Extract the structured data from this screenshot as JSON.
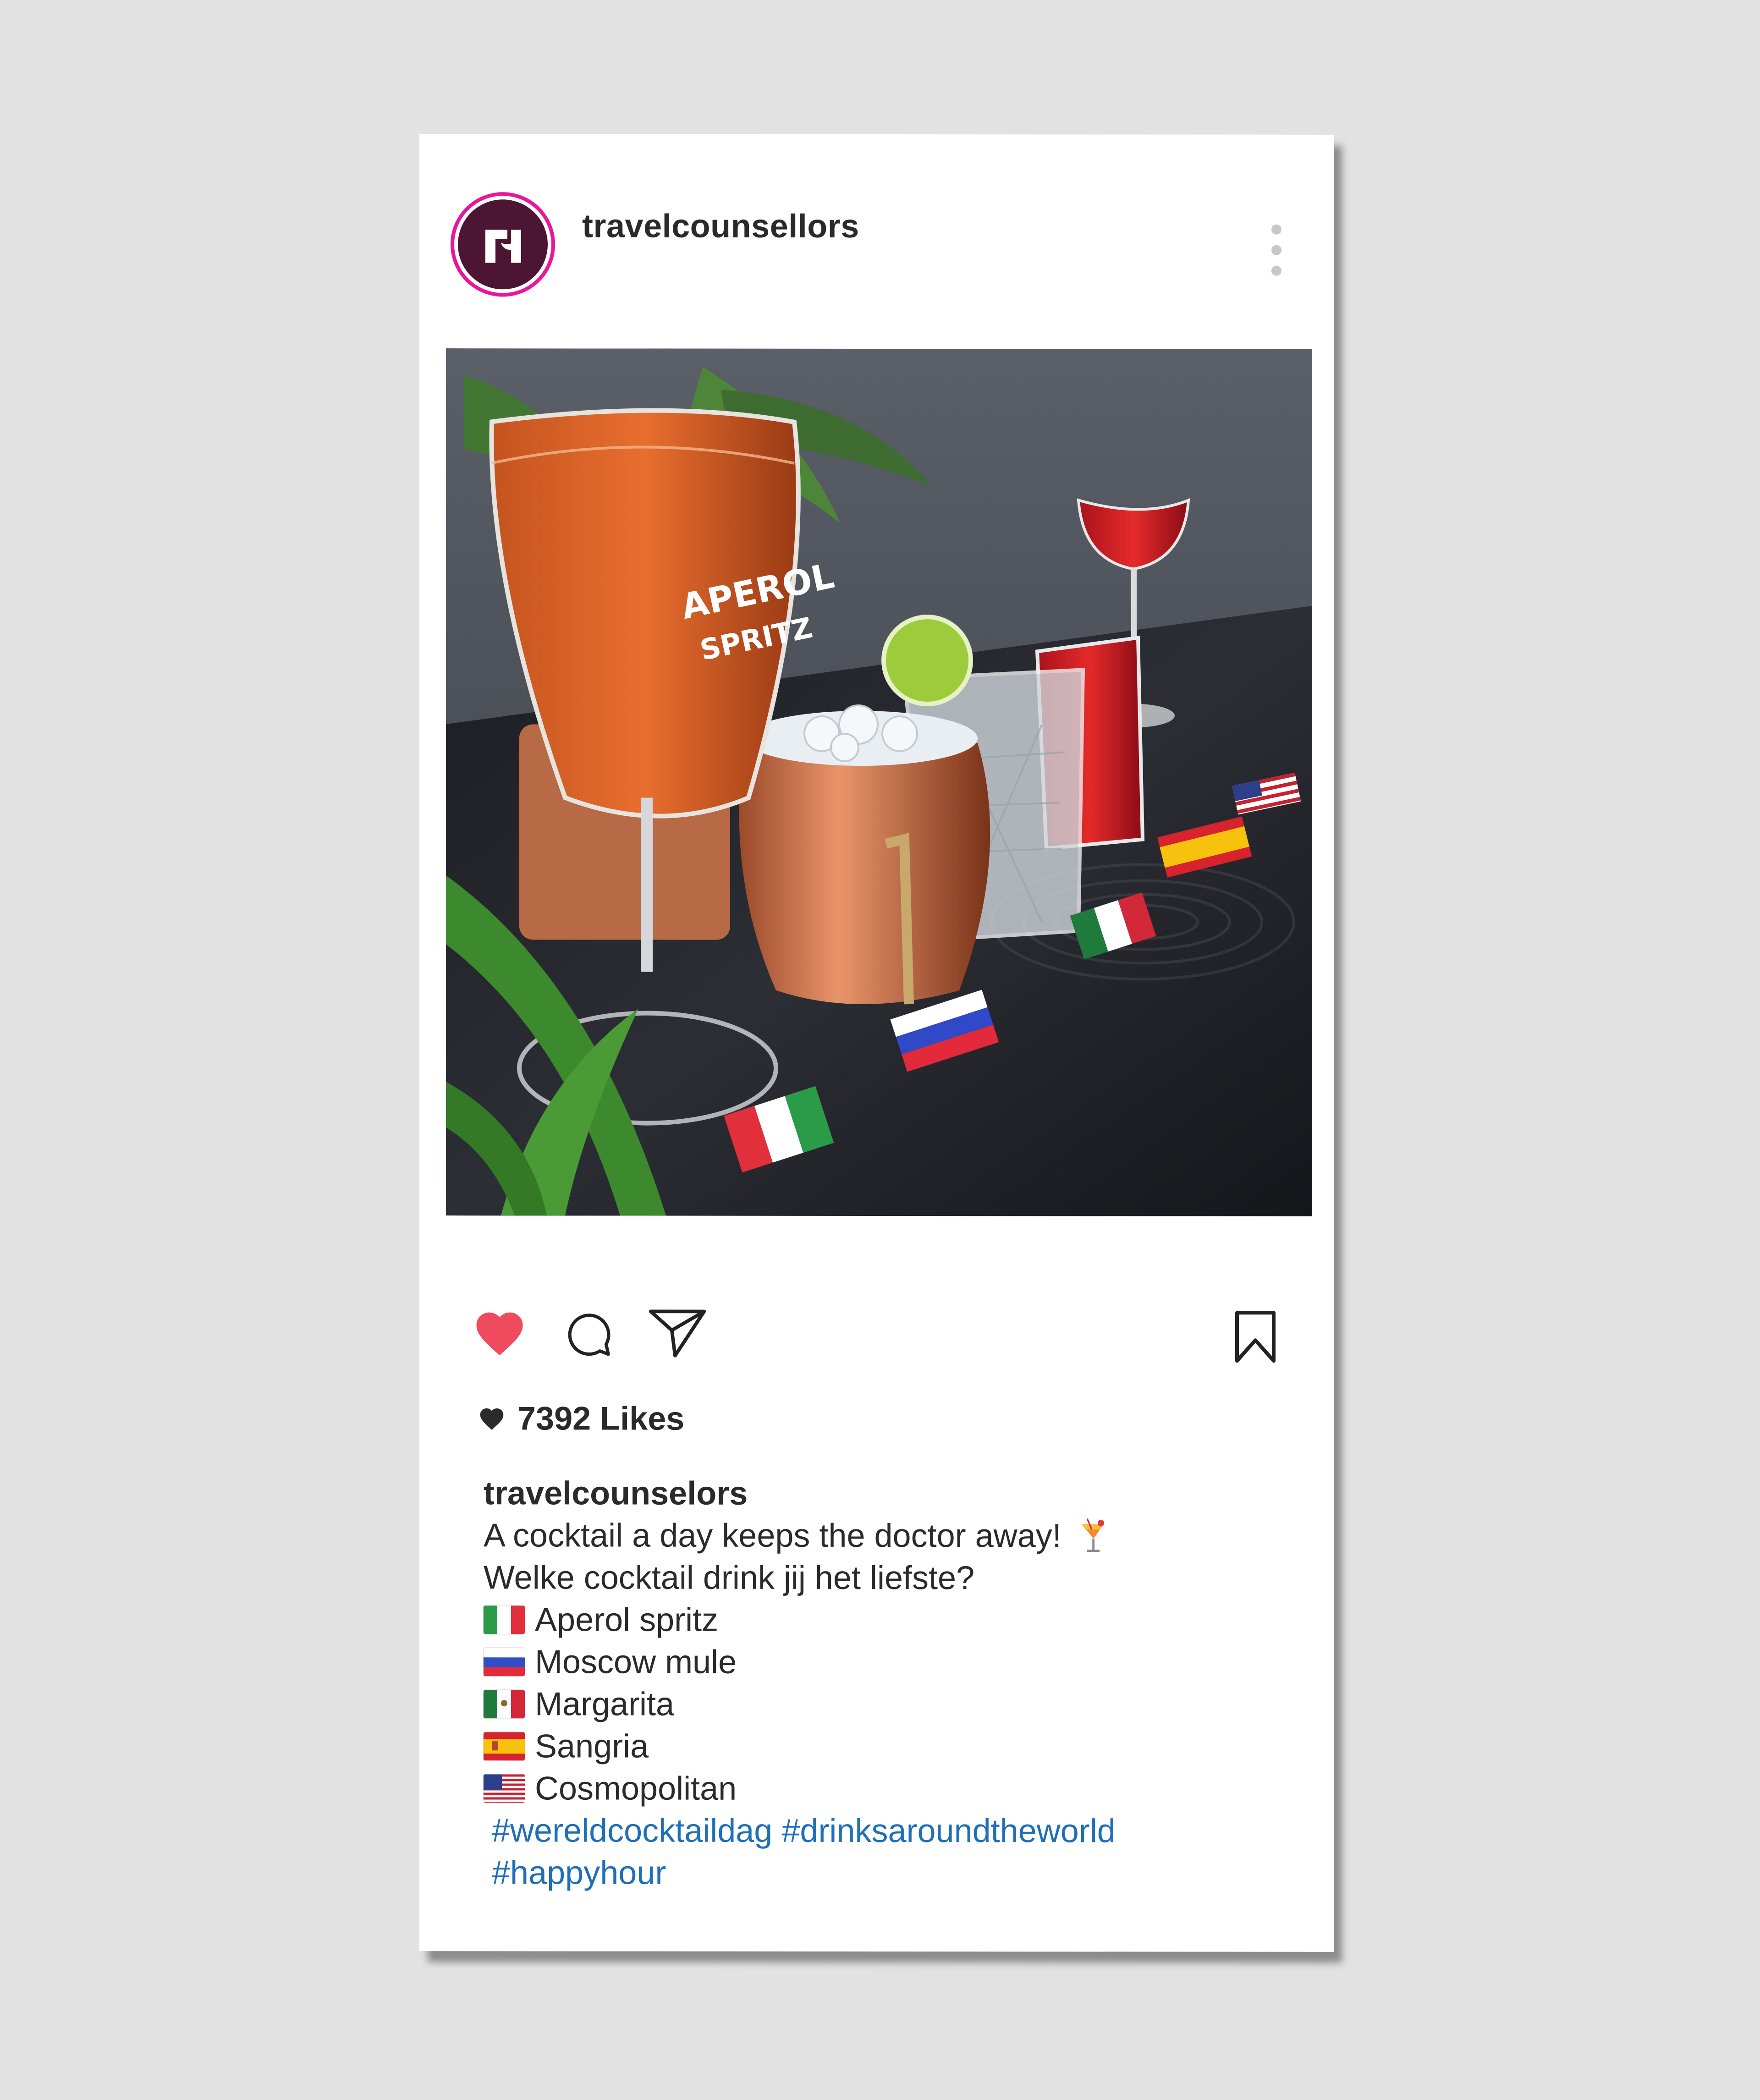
{
  "post": {
    "username": "travelcounsellors",
    "likes_text": "7392 Likes",
    "caption": {
      "username": "travelcounselors",
      "line1": "A cocktail a day keeps the doctor away!",
      "line1_emoji": "tropical-drink",
      "line2": "Welke cocktail drink jij het liefste?",
      "items": [
        {
          "flag": "italy",
          "label": "Aperol spritz"
        },
        {
          "flag": "russia",
          "label": "Moscow mule"
        },
        {
          "flag": "mexico",
          "label": "Margarita"
        },
        {
          "flag": "spain",
          "label": "Sangria"
        },
        {
          "flag": "usa",
          "label": "Cosmopolitan"
        }
      ],
      "hashtags_line1": "#wereldcocktaildag #drinksaroundtheworld",
      "hashtags_line2": "#happyhour"
    },
    "image": {
      "glass_text_1": "APEROL",
      "glass_text_2": "SPRITZ"
    }
  },
  "colors": {
    "like_active": "#f04a5e",
    "hashtag": "#1f6fb8",
    "avatar_ring": "#e6179a",
    "avatar_bg": "#4b1533"
  },
  "icons": [
    "heart-icon",
    "comment-icon",
    "share-icon",
    "bookmark-icon",
    "more-options-icon"
  ]
}
